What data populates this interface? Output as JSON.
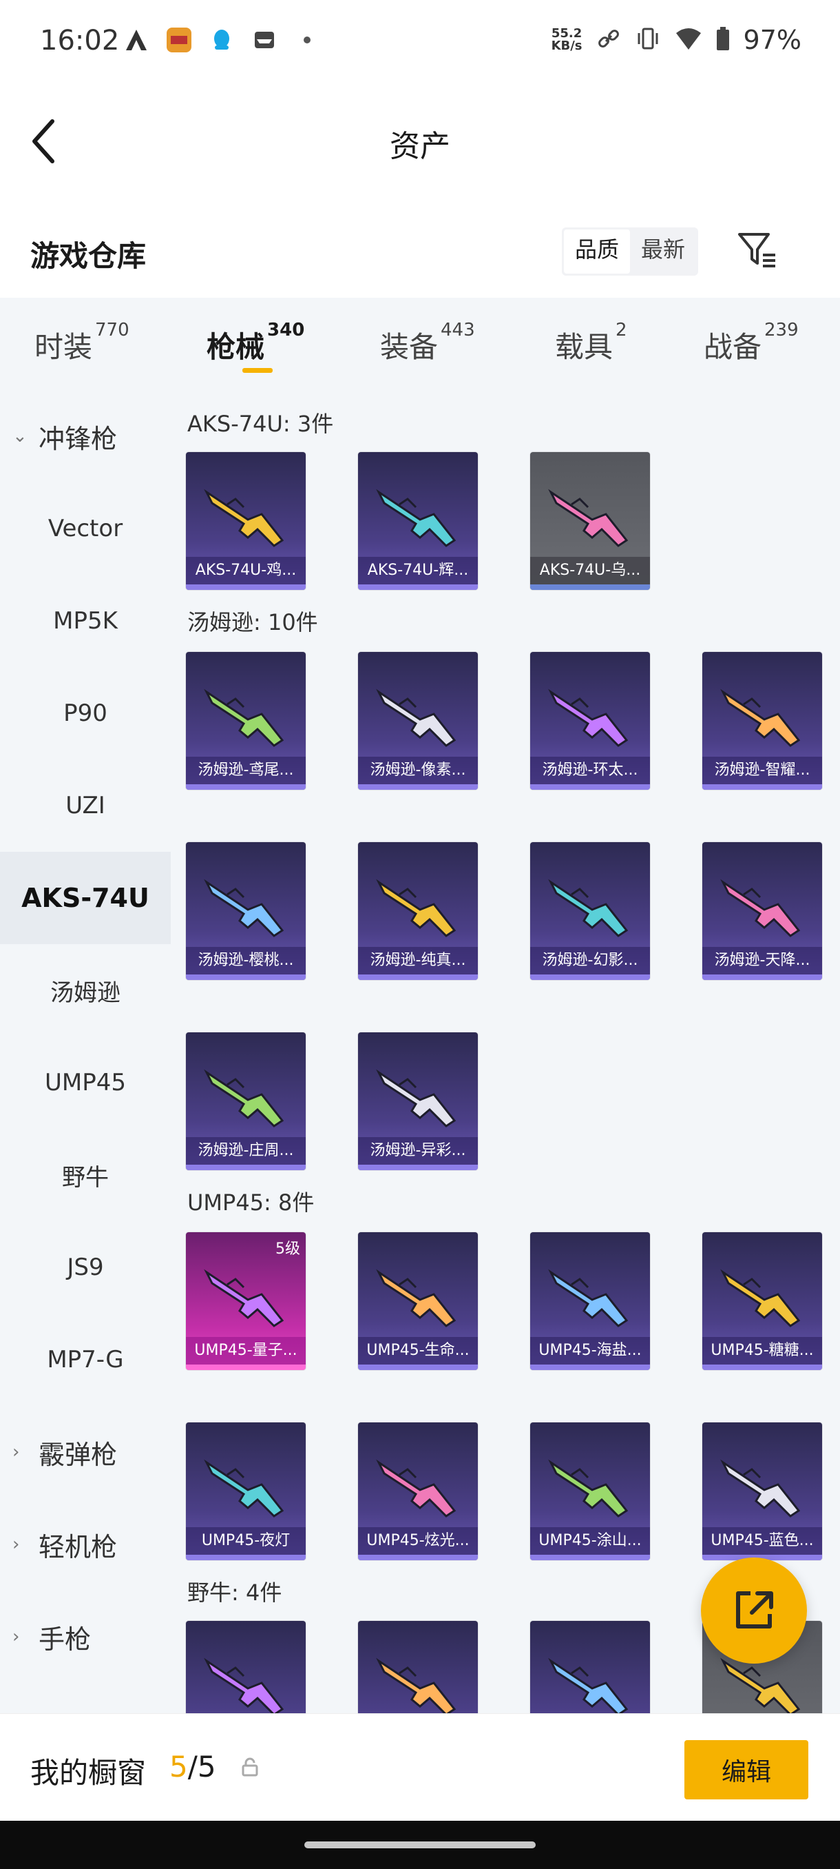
{
  "status_bar": {
    "time": "16:02",
    "speed_value": "55.2",
    "speed_unit": "KB/s",
    "battery": "97%",
    "icons": [
      "a-icon",
      "game-app-icon",
      "qq-icon",
      "mail-icon",
      "dot-icon",
      "link-icon",
      "vibrate-icon",
      "wifi-icon",
      "battery-icon"
    ]
  },
  "header": {
    "title": "资产"
  },
  "warehouse": {
    "title": "游戏仓库",
    "sort_options": [
      "品质",
      "最新"
    ],
    "active_sort": "品质"
  },
  "tabs": [
    {
      "label": "时装",
      "count": "770"
    },
    {
      "label": "枪械",
      "count": "340"
    },
    {
      "label": "装备",
      "count": "443"
    },
    {
      "label": "载具",
      "count": "2"
    },
    {
      "label": "战备",
      "count": "239"
    }
  ],
  "active_tab": "枪械",
  "sidebar": {
    "category_open": "冲锋枪",
    "items": [
      "Vector",
      "MP5K",
      "P90",
      "UZI",
      "AKS-74U",
      "汤姆逊",
      "UMP45",
      "野牛",
      "JS9",
      "MP7-G"
    ],
    "active_item": "AKS-74U",
    "categories_closed": [
      "霰弹枪",
      "轻机枪",
      "手枪"
    ]
  },
  "groups": [
    {
      "title": "AKS-74U: 3件",
      "items": [
        "AKS-74U-鸡...",
        "AKS-74U-辉...",
        "AKS-74U-乌..."
      ]
    },
    {
      "title": "汤姆逊: 10件",
      "items": [
        "汤姆逊-鸢尾...",
        "汤姆逊-像素...",
        "汤姆逊-环太...",
        "汤姆逊-智耀...",
        "汤姆逊-樱桃...",
        "汤姆逊-纯真...",
        "汤姆逊-幻影...",
        "汤姆逊-天降...",
        "汤姆逊-庄周...",
        "汤姆逊-异彩..."
      ]
    },
    {
      "title": "UMP45: 8件",
      "items": [
        "UMP45-量子...",
        "UMP45-生命...",
        "UMP45-海盐...",
        "UMP45-糖糖...",
        "UMP45-夜灯",
        "UMP45-炫光...",
        "UMP45-涂山...",
        "UMP45-蓝色..."
      ],
      "badge": "5级"
    },
    {
      "title": "野牛: 4件",
      "items": [
        "",
        "",
        "",
        ""
      ]
    }
  ],
  "bottom_bar": {
    "label": "我的橱窗",
    "count_current": "5",
    "count_total": "/5",
    "edit_label": "编辑"
  },
  "colors": {
    "accent": "#f6b200",
    "card_purple": "#4b3f87",
    "card_pink": "#c42fa9"
  }
}
